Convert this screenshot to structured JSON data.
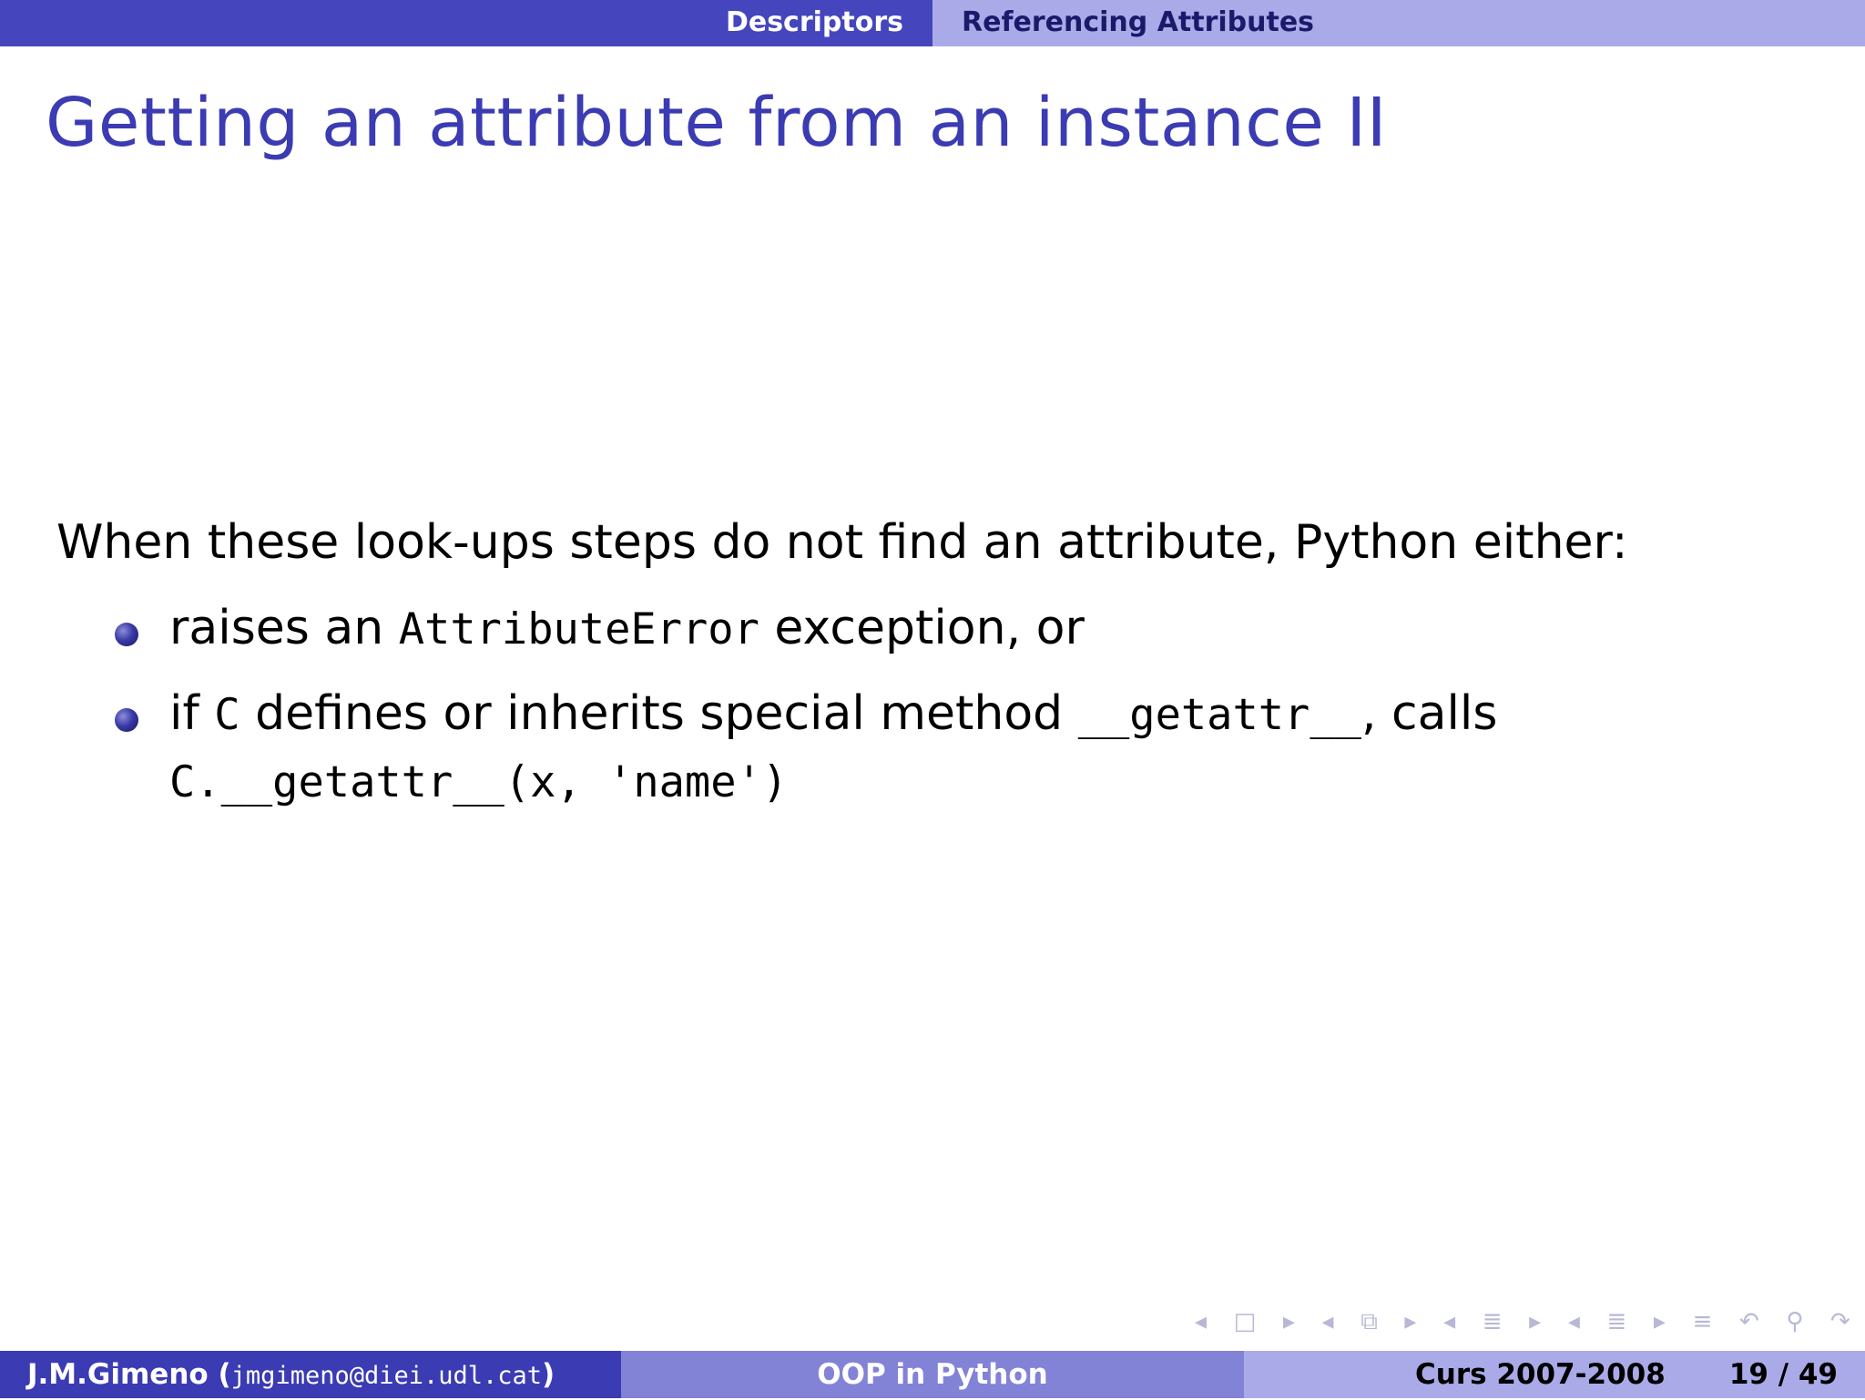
{
  "header": {
    "section": "Descriptors",
    "subsection": "Referencing Attributes"
  },
  "slide": {
    "title": "Getting an attribute from an instance II",
    "intro": "When these look-ups steps do not find an attribute, Python either:",
    "bullets": [
      {
        "pre": "raises an ",
        "code": "AttributeError",
        "post": " exception, or"
      },
      {
        "pre": "if ",
        "code1": "C",
        "mid": " defines or inherits special method ",
        "code2": "__getattr__",
        "post": ", calls",
        "line2": "C.__getattr__(x, 'name')"
      }
    ]
  },
  "footer": {
    "author": "J.M.Gimeno",
    "email": "jmgimeno@diei.udl.cat",
    "talk": "OOP in Python",
    "course": "Curs 2007-2008",
    "page": "19 / 49"
  },
  "nav_icons": [
    "arrow-left",
    "frame",
    "arrow-right",
    "arrow-left",
    "subsection",
    "arrow-right",
    "arrow-left",
    "section",
    "arrow-right",
    "arrow-left",
    "document",
    "arrow-right",
    "align",
    "undo",
    "search",
    "redo"
  ]
}
